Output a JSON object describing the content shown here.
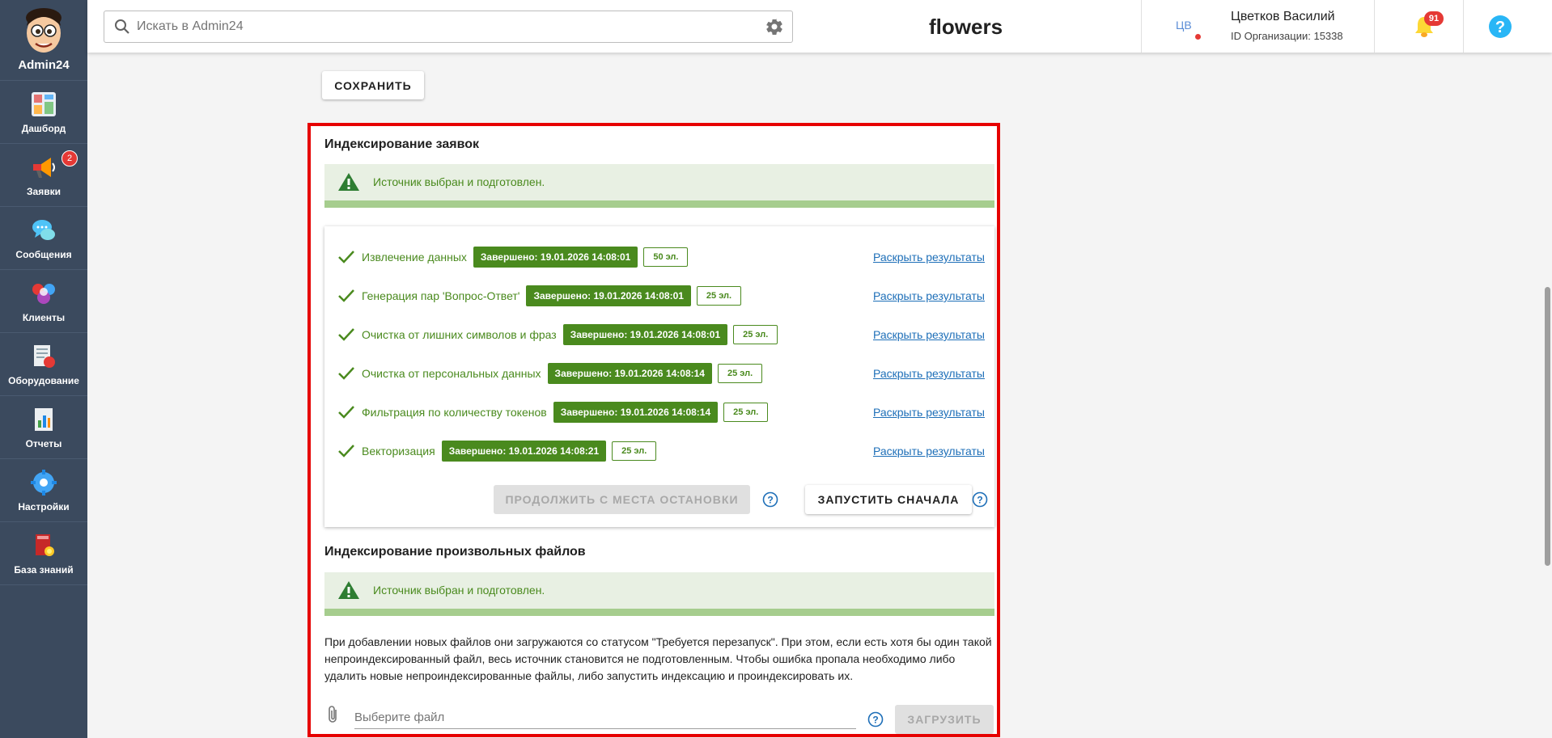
{
  "sidebar": {
    "brand": "Admin24",
    "items": [
      {
        "label": "Дашборд",
        "icon": "dashboard-icon"
      },
      {
        "label": "Заявки",
        "icon": "megaphone-icon",
        "badge": "2"
      },
      {
        "label": "Сообщения",
        "icon": "chat-icon"
      },
      {
        "label": "Клиенты",
        "icon": "clients-icon"
      },
      {
        "label": "Оборудование",
        "icon": "equipment-icon"
      },
      {
        "label": "Отчеты",
        "icon": "reports-icon"
      },
      {
        "label": "Настройки",
        "icon": "settings-icon"
      },
      {
        "label": "База знаний",
        "icon": "knowledge-base-icon"
      }
    ]
  },
  "header": {
    "search_placeholder": "Искать в Admin24",
    "org_title": "flowers",
    "user_initials": "ЦВ",
    "user_name": "Цветков Василий",
    "org_id": "ID Организации: 15338",
    "notifications_count": "91"
  },
  "main": {
    "save_label": "СОХРАНИТЬ",
    "requests_section": {
      "title": "Индексирование заявок",
      "alert": "Источник выбран и подготовлен.",
      "steps": [
        {
          "label": "Извлечение данных",
          "status": "Завершено: 19.01.2026 14:08:01",
          "count": "50 эл.",
          "link": "Раскрыть результаты"
        },
        {
          "label": "Генерация пар 'Вопрос-Ответ'",
          "status": "Завершено: 19.01.2026 14:08:01",
          "count": "25 эл.",
          "link": "Раскрыть результаты"
        },
        {
          "label": "Очистка от лишних символов и фраз",
          "status": "Завершено: 19.01.2026 14:08:01",
          "count": "25 эл.",
          "link": "Раскрыть результаты"
        },
        {
          "label": "Очистка от персональных данных",
          "status": "Завершено: 19.01.2026 14:08:14",
          "count": "25 эл.",
          "link": "Раскрыть результаты"
        },
        {
          "label": "Фильтрация по количеству токенов",
          "status": "Завершено: 19.01.2026 14:08:14",
          "count": "25 эл.",
          "link": "Раскрыть результаты"
        },
        {
          "label": "Векторизация",
          "status": "Завершено: 19.01.2026 14:08:21",
          "count": "25 эл.",
          "link": "Раскрыть результаты"
        }
      ],
      "continue_label": "ПРОДОЛЖИТЬ С МЕСТА ОСТАНОВКИ",
      "restart_label": "ЗАПУСТИТЬ СНАЧАЛА"
    },
    "files_section": {
      "title": "Индексирование произвольных файлов",
      "alert": "Источник выбран и подготовлен.",
      "description": "При добавлении новых файлов они загружаются со статусом \"Требуется перезапуск\". При этом, если есть хотя бы один такой непроиндексированный файл, весь источник становится не подготовленным. Чтобы ошибка пропала необходимо либо удалить новые непроиндексированные файлы, либо запустить индексацию и проиндексировать их.",
      "file_placeholder": "Выберите файл",
      "upload_label": "ЗАГРУЗИТЬ"
    }
  },
  "colors": {
    "sidebar_bg": "#3b4a5e",
    "success_green": "#4a8a1e",
    "alert_bg": "#e8f0e3",
    "highlight_border": "#e60000",
    "link_blue": "#1e6fb8"
  }
}
